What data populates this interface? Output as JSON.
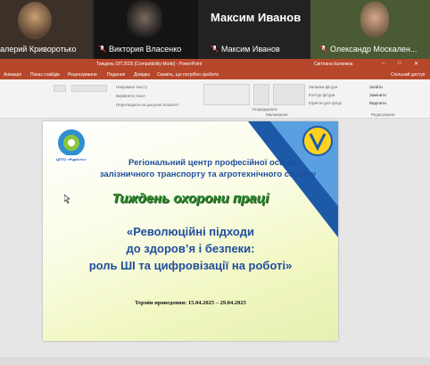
{
  "participants": [
    {
      "name": "алерий Криворотько"
    },
    {
      "name": "Виктория Власенко"
    },
    {
      "name": "Максим Иванов"
    },
    {
      "name": "Олександр Москален..."
    }
  ],
  "active_speaker": "Максим Иванов",
  "window": {
    "title": "Тиждень ОП 2025 [Compatibility Mode] - PowerPoint",
    "user": "Світлана Калюжна",
    "share_label": "Спільний доступ"
  },
  "menu": [
    "Анімація",
    "Показ слайдів",
    "Рецензування",
    "Подання",
    "Довідка",
    "Скажіть, що потрібно зробити"
  ],
  "ribbon": {
    "group_drawing": "Малювання",
    "group_editing": "Редагування",
    "find": "Знайти",
    "replace": "Замінити",
    "select": "Виділити",
    "arrange": "Упорядкувати",
    "shape_fill": "Заливка фігури",
    "shape_outline": "Контур фігури",
    "shape_effects": "Ефекти для фігур",
    "text_direction": "Напрямок тексту",
    "align_text": "Вирівняти текст",
    "smartart": "Перетворити на рисунок SmartArt"
  },
  "slide": {
    "logo_text": "ЦПТО «Рідністъ»",
    "line1": "Регіональний центр професійної освіти",
    "line2": "залізничного транспорту та агротехнічного сервісу",
    "week": "Тиждень охорони праці",
    "q1": "«Революційні підходи",
    "q2": "до здоров’я і безпеки:",
    "q3": "роль ШІ та цифровізації на роботі»",
    "term": "Термін проведення: 15.04.2025 – 29.04.2025"
  },
  "colors": {
    "ppt_accent": "#b7472a",
    "slide_blue": "#1f4e9d",
    "slide_green": "#2e8b2e"
  }
}
